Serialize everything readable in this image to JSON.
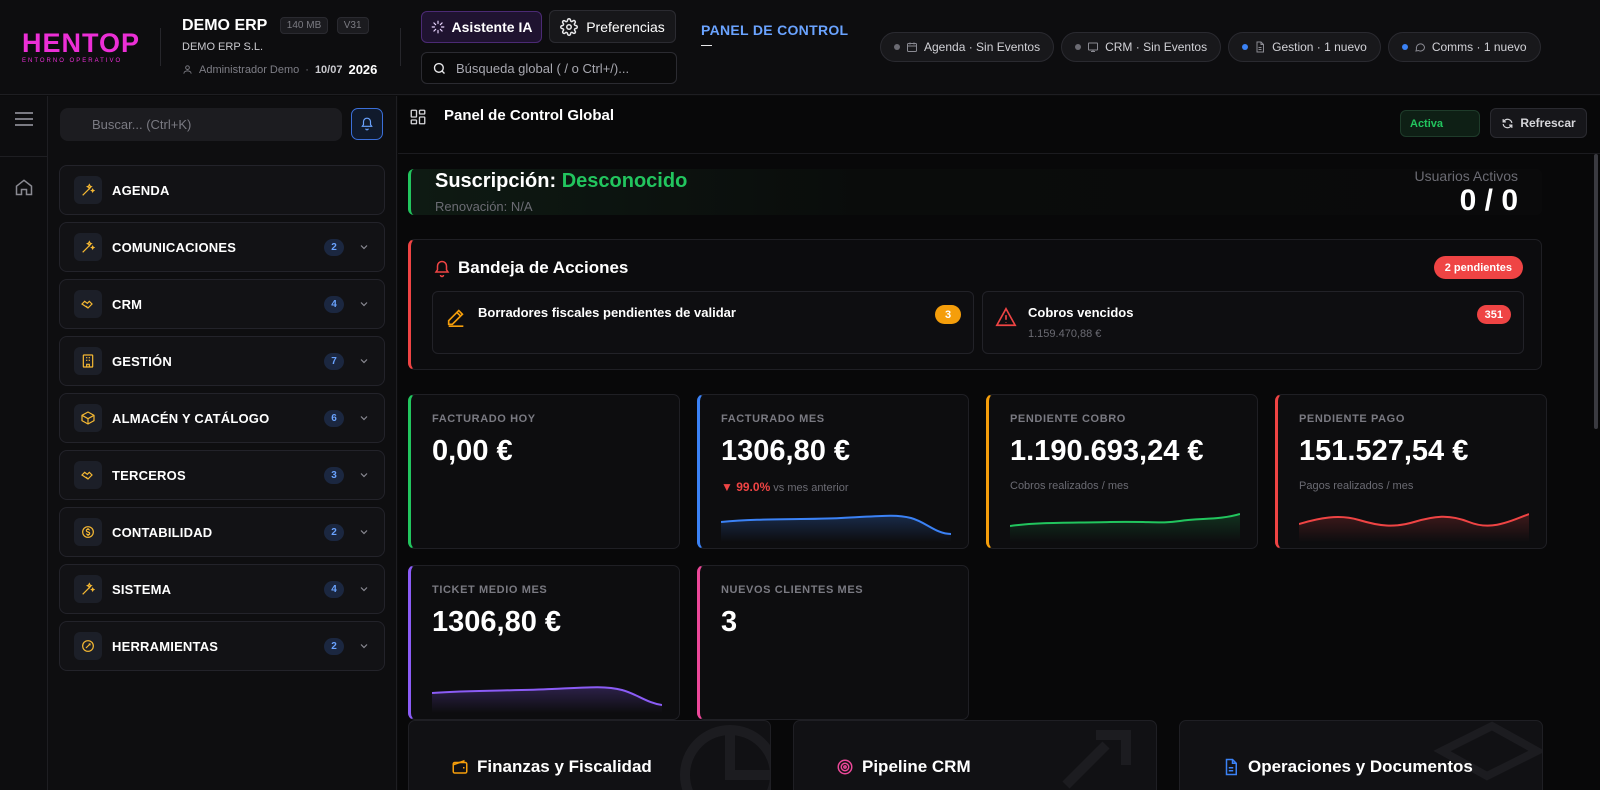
{
  "header": {
    "logo_text": "HENTOP",
    "logo_sub": "ENTORNO OPERATIVO",
    "company_title": "DEMO ERP",
    "size_chip": "140 MB",
    "version_chip": "V31",
    "company_name": "DEMO ERP S.L.",
    "user_name": "Administrador Demo",
    "date_short": "10/07",
    "year": "2026",
    "ai_button": "Asistente IA",
    "prefs_button": "Preferencias",
    "search_placeholder": "Búsqueda global ( / o Ctrl+/)...",
    "panel_link": "PANEL DE CONTROL",
    "pills": [
      {
        "icon": "calendar-icon",
        "label": "Agenda · Sin Eventos",
        "dot_color": "#6b6b73"
      },
      {
        "icon": "crm-icon",
        "label": "CRM · Sin Eventos",
        "dot_color": "#6b6b73"
      },
      {
        "icon": "document-icon",
        "label": "Gestion · 1 nuevo",
        "dot_color": "#3b82f6"
      },
      {
        "icon": "chat-icon",
        "label": "Comms · 1 nuevo",
        "dot_color": "#3b82f6"
      }
    ]
  },
  "sidebar": {
    "search_placeholder": "Buscar... (Ctrl+K)",
    "items": [
      {
        "label": "AGENDA",
        "count": null
      },
      {
        "label": "COMUNICACIONES",
        "count": "2"
      },
      {
        "label": "CRM",
        "count": "4"
      },
      {
        "label": "GESTIÓN",
        "count": "7"
      },
      {
        "label": "ALMACÉN Y CATÁLOGO",
        "count": "6"
      },
      {
        "label": "TERCEROS",
        "count": "3"
      },
      {
        "label": "CONTABILIDAD",
        "count": "2"
      },
      {
        "label": "SISTEMA",
        "count": "4"
      },
      {
        "label": "HERRAMIENTAS",
        "count": "2"
      }
    ]
  },
  "main": {
    "title": "Panel de Control Global",
    "status": "Activa",
    "refresh": "Refrescar",
    "subscription": {
      "label": "Suscripción:",
      "value": "Desconocido",
      "renewal": "Renovación: N/A",
      "users_label": "Usuarios Activos",
      "users_value": "0 / 0"
    },
    "inbox": {
      "title": "Bandeja de Acciones",
      "badge": "2 pendientes",
      "actions": [
        {
          "title": "Borradores fiscales pendientes de validar",
          "sub": "",
          "badge": "3",
          "badge_color": "#f59e0b"
        },
        {
          "title": "Cobros vencidos",
          "sub": "1.159.470,88 €",
          "badge": "351",
          "badge_color": "#ef4444"
        }
      ]
    },
    "kpis": [
      {
        "label": "FACTURADO HOY",
        "value": "0,00 €",
        "sub": "",
        "color": "#22c55e"
      },
      {
        "label": "FACTURADO MES",
        "value": "1306,80 €",
        "delta": "▼ 99.0%",
        "delta_suffix": " vs mes anterior",
        "color": "#3b82f6"
      },
      {
        "label": "PENDIENTE COBRO",
        "value": "1.190.693,24 €",
        "sub": "Cobros realizados / mes",
        "color": "#f59e0b"
      },
      {
        "label": "PENDIENTE PAGO",
        "value": "151.527,54 €",
        "sub": "Pagos realizados / mes",
        "color": "#ef4444"
      },
      {
        "label": "TICKET MEDIO MES",
        "value": "1306,80 €",
        "sub": "",
        "color": "#8b5cf6"
      },
      {
        "label": "NUEVOS CLIENTES MES",
        "value": "3",
        "sub": "",
        "color": "#ec4899"
      }
    ],
    "bottom_cards": [
      {
        "title": "Finanzas y Fiscalidad",
        "icon": "wallet-icon"
      },
      {
        "title": "Pipeline CRM",
        "icon": "target-icon"
      },
      {
        "title": "Operaciones y Documentos",
        "icon": "document-icon"
      }
    ]
  },
  "colors": {
    "accent": "#3b82f6",
    "brand": "#ec2fd6",
    "success": "#22c55e",
    "danger": "#ef4444",
    "warning": "#f59e0b"
  }
}
